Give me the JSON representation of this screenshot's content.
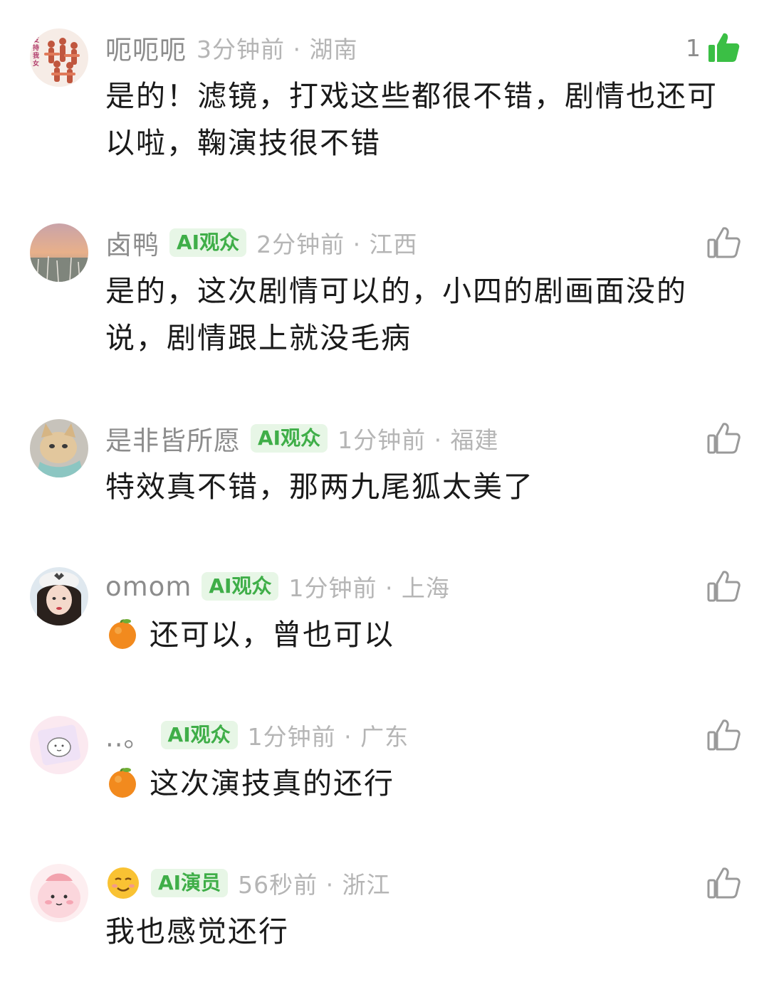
{
  "comments": [
    {
      "username": "呃呃呃",
      "avatar_icon": "dancers-avatar",
      "avatar_text": "支持我女",
      "badge": "",
      "meta": "3分钟前 · 湖南",
      "text": "是的！滤镜，打戏这些都很不错，剧情也还可以啦，鞠演技很不错",
      "likes": "1",
      "liked": true
    },
    {
      "username": "卤鸭",
      "avatar_icon": "sunset-landscape-avatar",
      "badge": "AI观众",
      "meta": "2分钟前 · 江西",
      "text": "是的，这次剧情可以的，小四的剧画面没的说，剧情跟上就没毛病",
      "likes": "",
      "liked": false
    },
    {
      "username": "是非皆所愿",
      "avatar_icon": "cat-avatar",
      "badge": "AI观众",
      "meta": "1分钟前 · 福建",
      "text": "特效真不错，那两九尾狐太美了",
      "likes": "",
      "liked": false
    },
    {
      "username": "omom",
      "avatar_icon": "girl-avatar",
      "badge": "AI观众",
      "meta": "1分钟前 · 上海",
      "emoji": "orange-emoji",
      "text": "还可以，曾也可以",
      "likes": "",
      "liked": false
    },
    {
      "username": "..。",
      "avatar_icon": "cartoon-pink-avatar",
      "badge": "AI观众",
      "meta": "1分钟前 · 广东",
      "emoji": "orange-emoji",
      "text": "这次演技真的还行",
      "likes": "",
      "liked": false
    },
    {
      "username": "",
      "username_emoji": "smiling-face-emoji",
      "avatar_icon": "pink-blob-avatar",
      "badge": "AI演员",
      "meta": "56秒前 · 浙江",
      "text": "我也感觉还行",
      "likes": "",
      "liked": false
    }
  ],
  "colors": {
    "badge_bg": "#e7f6e6",
    "badge_text": "#3fae48",
    "like_active": "#3bbf45",
    "like_idle": "#9a9a9a"
  }
}
